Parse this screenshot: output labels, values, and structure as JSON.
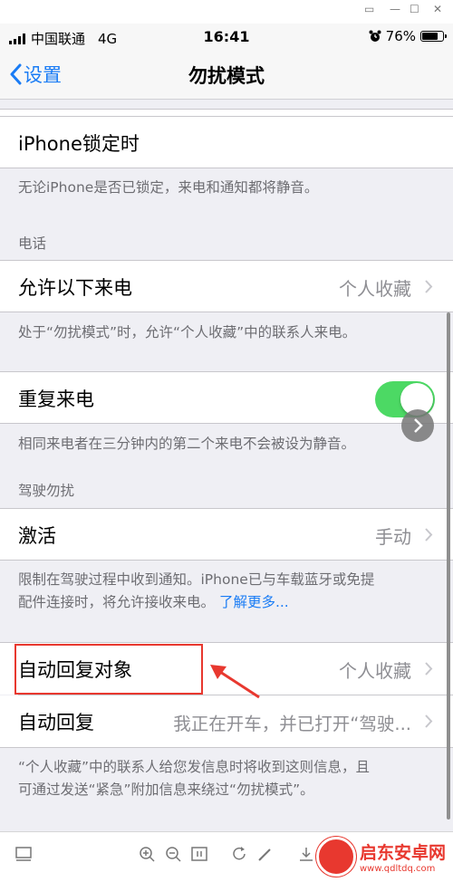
{
  "status_bar": {
    "carrier": "中国联通",
    "network": "4G",
    "time": "16:41",
    "battery": "76%",
    "battery_level": 0.76
  },
  "nav": {
    "back_label": "设置",
    "title": "勿扰模式"
  },
  "rows": {
    "locked_label": "iPhone锁定时",
    "locked_footer": "无论iPhone是否已锁定，来电和通知都将静音。",
    "phone_header": "电话",
    "allow_calls_label": "允许以下来电",
    "allow_calls_value": "个人收藏",
    "allow_calls_footer": "处于“勿扰模式”时，允许“个人收藏”中的联系人来电。",
    "repeated_calls_label": "重复来电",
    "repeated_calls_on": true,
    "repeated_calls_footer": "相同来电者在三分钟内的第二个来电不会被设为静音。",
    "driving_header": "驾驶勿扰",
    "activate_label": "激活",
    "activate_value": "手动",
    "driving_footer_line1": "限制在驾驶过程中收到通知。iPhone已与车载蓝牙或免提",
    "driving_footer_line2": "配件连接时，将允许接收来电。",
    "learn_more": "了解更多...",
    "auto_reply_to_label": "自动回复对象",
    "auto_reply_to_value": "个人收藏",
    "auto_reply_label": "自动回复",
    "auto_reply_value": "我正在开车，并已打开“驾驶...",
    "auto_reply_footer_line1": "“个人收藏”中的联系人给您发信息时将收到这则信息，且",
    "auto_reply_footer_line2": "可通过发送“紧急”附加信息来绕过“勿扰模式”。"
  },
  "watermark": {
    "name": "启东安卓网",
    "url": "www.qdltdq.com"
  },
  "colors": {
    "accent": "#1a7cf5",
    "toggle_on": "#4cd964",
    "annotation": "#e8382f"
  }
}
